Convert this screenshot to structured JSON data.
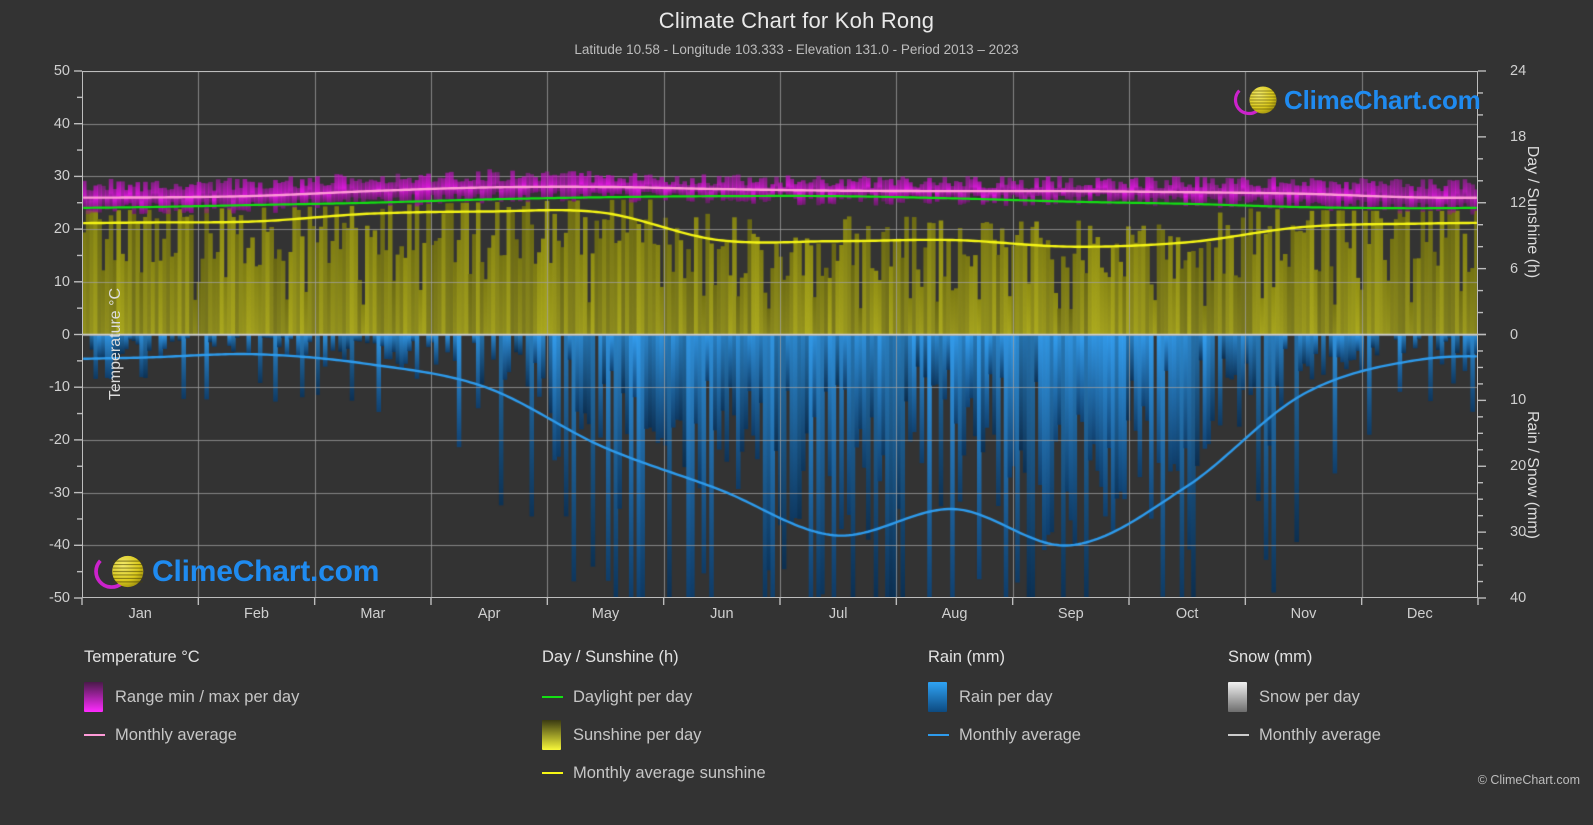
{
  "header": {
    "title": "Climate Chart for Koh Rong",
    "subtitle": "Latitude 10.58 - Longitude 103.333 - Elevation 131.0 - Period 2013 – 2023"
  },
  "watermark": {
    "text": "ClimeChart.com"
  },
  "footer": {
    "copyright": "© ClimeChart.com"
  },
  "axes": {
    "left_title": "Temperature °C",
    "right_title_top": "Day / Sunshine (h)",
    "right_title_bottom": "Rain / Snow (mm)",
    "left_ticks": [
      "50",
      "40",
      "30",
      "20",
      "10",
      "0",
      "-10",
      "-20",
      "-30",
      "-40",
      "-50"
    ],
    "right_ticks_top": [
      "24",
      "18",
      "12",
      "6",
      "0"
    ],
    "right_ticks_bottom": [
      "10",
      "20",
      "30",
      "40"
    ],
    "x_ticks": [
      "Jan",
      "Feb",
      "Mar",
      "Apr",
      "May",
      "Jun",
      "Jul",
      "Aug",
      "Sep",
      "Oct",
      "Nov",
      "Dec"
    ]
  },
  "legend": {
    "columns": [
      {
        "heading": "Temperature °C",
        "items": [
          {
            "label": "Range min / max per day",
            "marker": "swatch",
            "color": "#e800e8"
          },
          {
            "label": "Monthly average",
            "marker": "line",
            "color": "#ff9bd8"
          }
        ]
      },
      {
        "heading": "Day / Sunshine (h)",
        "items": [
          {
            "label": "Daylight per day",
            "marker": "line",
            "color": "#13e013"
          },
          {
            "label": "Sunshine per day",
            "marker": "swatch",
            "color": "#f3f32a"
          },
          {
            "label": "Monthly average sunshine",
            "marker": "line",
            "color": "#f6f615"
          }
        ]
      },
      {
        "heading": "Rain (mm)",
        "items": [
          {
            "label": "Rain per day",
            "marker": "swatch",
            "color": "#1f90e8"
          },
          {
            "label": "Monthly average",
            "marker": "line",
            "color": "#2e9bec"
          }
        ]
      },
      {
        "heading": "Snow (mm)",
        "items": [
          {
            "label": "Snow per day",
            "marker": "swatch",
            "color": "#e6e6e6"
          },
          {
            "label": "Monthly average",
            "marker": "line",
            "color": "#cccccc"
          }
        ]
      }
    ]
  },
  "colors": {
    "background": "#333333",
    "grid": "#8c8c8c",
    "axis": "#bdbdbd",
    "temp_band": "#e800e8",
    "temp_avg": "#ff9bd8",
    "daylight": "#13e013",
    "sunshine_fill": "#b0b022",
    "sunshine_avg": "#f6f615",
    "rain_fill": "#1f7fc8",
    "rain_avg": "#2e9bec",
    "brand_blue": "#1f8bf0",
    "brand_magenta": "#cc22cc",
    "brand_yellow": "#d4c417"
  },
  "chart_data": {
    "type": "area",
    "title": "Climate Chart for Koh Rong",
    "subtitle": "Latitude 10.58 - Longitude 103.333 - Elevation 131.0 - Period 2013 – 2023",
    "xlabel": "",
    "ylabel": "Temperature °C",
    "ylim": [
      -50,
      50
    ],
    "y2lim_top_hours": [
      24,
      0
    ],
    "y2lim_bottom_mm": [
      0,
      40
    ],
    "grid": true,
    "legend_position": "below",
    "categories": [
      "Jan",
      "Feb",
      "Mar",
      "Apr",
      "May",
      "Jun",
      "Jul",
      "Aug",
      "Sep",
      "Oct",
      "Nov",
      "Dec"
    ],
    "series": [
      {
        "name": "Temperature monthly average (°C)",
        "values": [
          26.0,
          26.3,
          27.2,
          27.9,
          28.0,
          27.6,
          27.3,
          27.2,
          27.2,
          27.0,
          26.7,
          26.0
        ]
      },
      {
        "name": "Temperature daily max (°C)",
        "values": [
          28.0,
          28.3,
          29.2,
          29.8,
          29.6,
          28.9,
          28.6,
          28.5,
          28.5,
          28.5,
          28.4,
          28.0
        ]
      },
      {
        "name": "Temperature daily min (°C)",
        "values": [
          24.2,
          24.5,
          25.4,
          26.3,
          26.5,
          26.3,
          26.0,
          25.9,
          25.9,
          25.6,
          25.1,
          24.3
        ]
      },
      {
        "name": "Daylight per day (h)",
        "values": [
          11.6,
          11.8,
          12.0,
          12.3,
          12.5,
          12.6,
          12.6,
          12.4,
          12.1,
          11.9,
          11.6,
          11.5
        ]
      },
      {
        "name": "Monthly average sunshine (h)",
        "values": [
          10.2,
          10.3,
          11.0,
          11.2,
          11.1,
          8.6,
          8.5,
          8.6,
          8.0,
          8.4,
          9.8,
          10.1
        ]
      },
      {
        "name": "Rain monthly average (mm)",
        "values": [
          3.5,
          3.0,
          4.5,
          8.0,
          17.0,
          23.5,
          30.5,
          26.5,
          32.0,
          23.0,
          9.0,
          3.8
        ]
      },
      {
        "name": "Snow monthly average (mm)",
        "values": [
          0,
          0,
          0,
          0,
          0,
          0,
          0,
          0,
          0,
          0,
          0,
          0
        ]
      }
    ]
  }
}
